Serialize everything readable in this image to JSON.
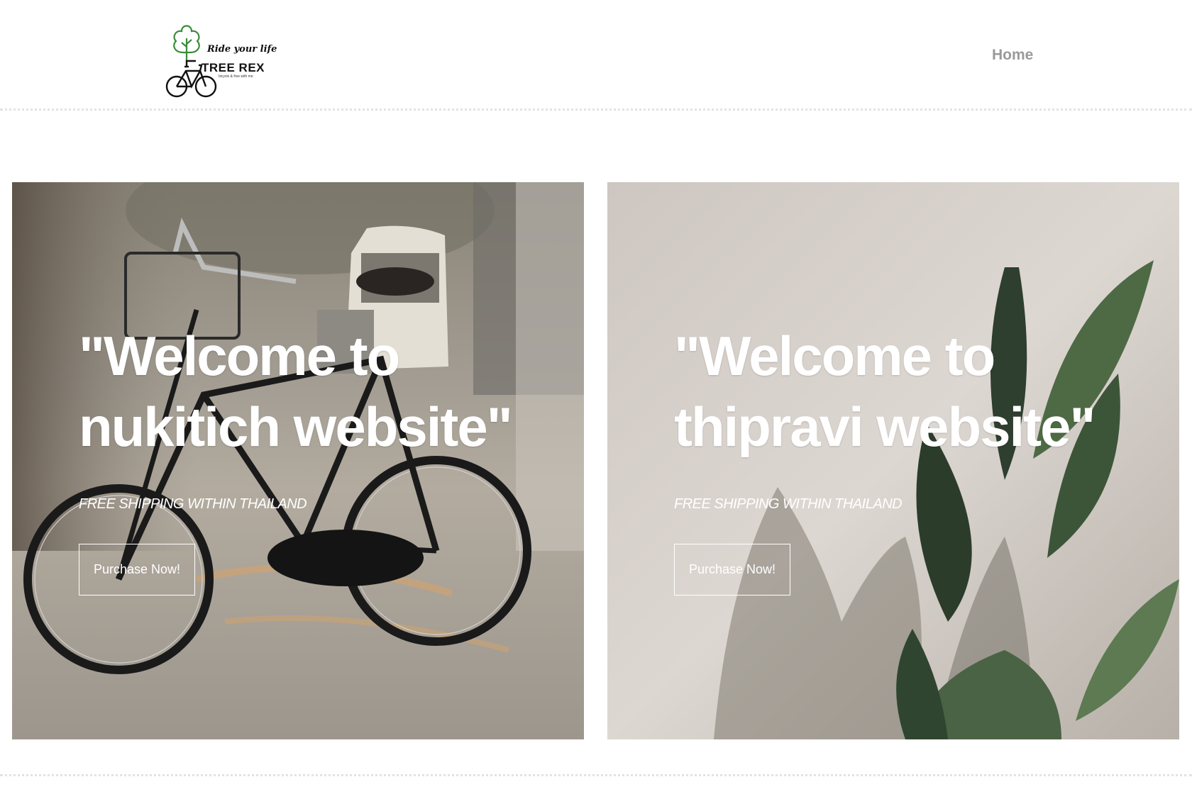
{
  "header": {
    "logo": {
      "tagline": "Ride your life",
      "name": "TREE REX",
      "subtitle": "bicycle & free with me"
    },
    "nav": {
      "home_label": "Home"
    }
  },
  "banners": [
    {
      "title": "\"Welcome to nukitich website\"",
      "subtitle": "FREE SHIPPING WITHIN THAILAND",
      "button_label": "Purchase Now!",
      "image": "bicycle-photo"
    },
    {
      "title": "\"Welcome to thipravi website\"",
      "subtitle": "FREE SHIPPING WITHIN THAILAND",
      "button_label": "Purchase Now!",
      "image": "plant-leaves-photo"
    }
  ],
  "colors": {
    "nav_text": "#9a9a9a",
    "logo_green": "#3d8a3a",
    "divider": "#e3e3e3"
  }
}
